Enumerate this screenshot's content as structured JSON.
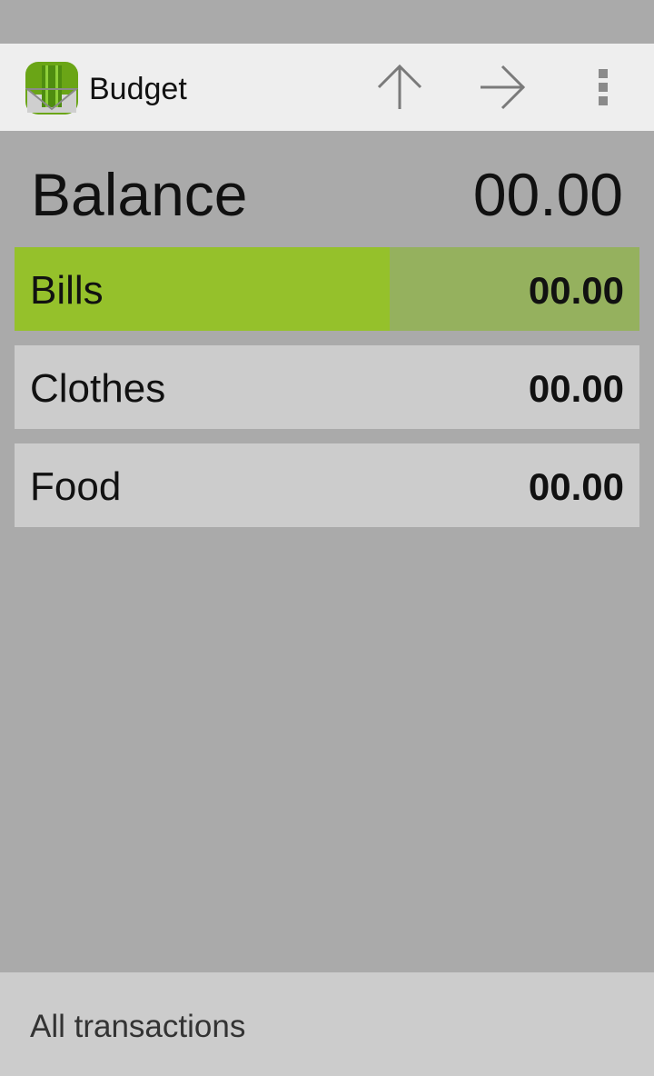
{
  "app": {
    "title": "Budget",
    "logo_icon": "budget-logo-icon",
    "accent_color": "#95c12b"
  },
  "action_bar": {
    "up_icon": "arrow-up-icon",
    "next_icon": "arrow-right-icon",
    "overflow_icon": "overflow-menu-icon"
  },
  "balance": {
    "label": "Balance",
    "value": "00.00"
  },
  "categories": [
    {
      "name": "Bills",
      "amount": "00.00",
      "selected": true,
      "fill_fraction": 0.6
    },
    {
      "name": "Clothes",
      "amount": "00.00",
      "selected": false,
      "fill_fraction": 0
    },
    {
      "name": "Food",
      "amount": "00.00",
      "selected": false,
      "fill_fraction": 0
    }
  ],
  "footer": {
    "label": "All transactions"
  }
}
